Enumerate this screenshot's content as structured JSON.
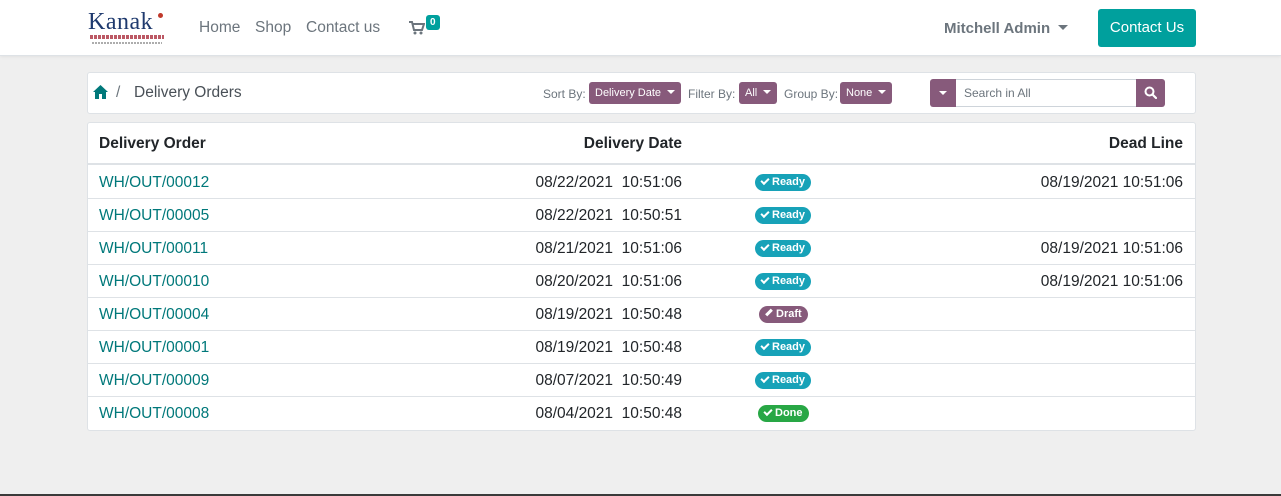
{
  "navbar": {
    "logo_text": "Kanak",
    "logo_tagline": "INFOSYSTEMS",
    "links": [
      {
        "label": "Home"
      },
      {
        "label": "Shop"
      },
      {
        "label": "Contact us"
      }
    ],
    "cart_count": "0",
    "user_name": "Mitchell Admin",
    "contact_button": "Contact Us",
    "colors": {
      "primary": "#00a09d",
      "secondary": "#875a7b",
      "link": "#00787a"
    }
  },
  "toolbar": {
    "breadcrumb_home_icon": "home-icon",
    "breadcrumb_separator": "/",
    "breadcrumb_current": "Delivery Orders",
    "sort_label": "Sort By:",
    "sort_value": "Delivery Date",
    "filter_label": "Filter By:",
    "filter_value": "All",
    "group_label": "Group By:",
    "group_value": "None",
    "search_placeholder": "Search in All",
    "search_icon": "search-icon"
  },
  "table": {
    "headers": {
      "order": "Delivery Order",
      "date": "Delivery Date",
      "deadline": "Dead Line"
    },
    "rows": [
      {
        "order": "WH/OUT/00012",
        "date": "08/22/2021  10:51:06",
        "status": "Ready",
        "status_color": "#17a2b8",
        "deadline": "08/19/2021 10:51:06"
      },
      {
        "order": "WH/OUT/00005",
        "date": "08/22/2021  10:50:51",
        "status": "Ready",
        "status_color": "#17a2b8",
        "deadline": ""
      },
      {
        "order": "WH/OUT/00011",
        "date": "08/21/2021  10:51:06",
        "status": "Ready",
        "status_color": "#17a2b8",
        "deadline": "08/19/2021 10:51:06"
      },
      {
        "order": "WH/OUT/00010",
        "date": "08/20/2021  10:51:06",
        "status": "Ready",
        "status_color": "#17a2b8",
        "deadline": "08/19/2021 10:51:06"
      },
      {
        "order": "WH/OUT/00004",
        "date": "08/19/2021  10:50:48",
        "status": "Draft",
        "status_color": "#875a7b",
        "deadline": ""
      },
      {
        "order": "WH/OUT/00001",
        "date": "08/19/2021  10:50:48",
        "status": "Ready",
        "status_color": "#17a2b8",
        "deadline": ""
      },
      {
        "order": "WH/OUT/00009",
        "date": "08/07/2021  10:50:49",
        "status": "Ready",
        "status_color": "#17a2b8",
        "deadline": ""
      },
      {
        "order": "WH/OUT/00008",
        "date": "08/04/2021  10:50:48",
        "status": "Done",
        "status_color": "#28a745",
        "deadline": ""
      }
    ]
  }
}
